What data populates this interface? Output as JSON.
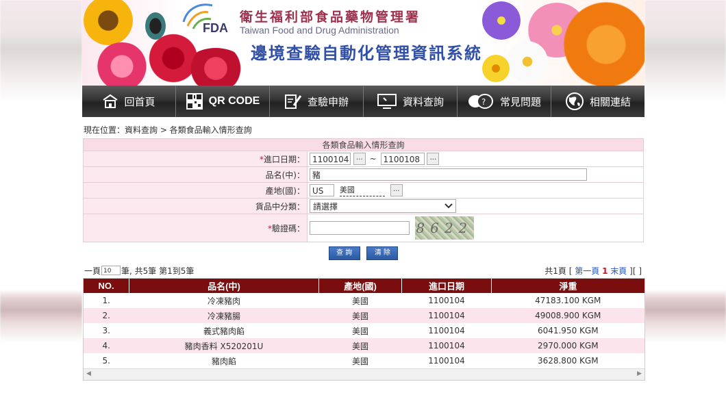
{
  "header": {
    "org_cn": "衛生福利部食品藥物管理署",
    "org_en": "Taiwan Food and Drug Administration",
    "fda_mark": "FDA",
    "system_title": "邊境查驗自動化管理資訊系統"
  },
  "nav": {
    "items": [
      {
        "label": "回首頁",
        "icon": "home-icon"
      },
      {
        "label": "QR CODE",
        "icon": "qr-code-icon"
      },
      {
        "label": "查驗申辦",
        "icon": "edit-document-icon"
      },
      {
        "label": "資料查詢",
        "icon": "monitor-icon"
      },
      {
        "label": "常見問題",
        "icon": "faq-chat-icon"
      },
      {
        "label": "相關連結",
        "icon": "globe-icon"
      }
    ]
  },
  "breadcrumb": "現在位置：資料查詢 > 各類食品輸入情形查詢",
  "form": {
    "title": "各類食品輸入情形查詢",
    "import_date": {
      "label": "進口日期：",
      "required_mark": "*",
      "from": "1100104",
      "to": "1100108",
      "separator": "~",
      "pick_label": "..."
    },
    "product_name": {
      "label": "品名(中)：",
      "value": "豬"
    },
    "origin": {
      "label": "產地(國)：",
      "code": "US",
      "name": "美國",
      "pick_label": "..."
    },
    "category": {
      "label": "貨品中分類：",
      "selected": "請選擇"
    },
    "captcha": {
      "label": "驗證碼：",
      "required_mark": "*",
      "code": "8622",
      "value": ""
    }
  },
  "buttons": {
    "query": "查 詢",
    "clear": "清 除"
  },
  "pager": {
    "prefix": "一頁",
    "page_size": "10",
    "summary": "筆, 共5筆 第1到5筆",
    "total_pages": "共1頁 [",
    "first": "第一頁",
    "current": "1",
    "last": "末頁",
    "suffix": "][ ]"
  },
  "results": {
    "columns": [
      "NO.",
      "品名(中)",
      "產地(國)",
      "進口日期",
      "淨重"
    ],
    "rows": [
      {
        "no": "1.",
        "name": "冷凍豬肉",
        "origin": "美國",
        "date": "1100104",
        "weight": "47183.100 KGM"
      },
      {
        "no": "2.",
        "name": "冷凍豬腸",
        "origin": "美國",
        "date": "1100104",
        "weight": "49008.900 KGM"
      },
      {
        "no": "3.",
        "name": "義式豬肉餡",
        "origin": "美國",
        "date": "1100104",
        "weight": "6041.950 KGM"
      },
      {
        "no": "4.",
        "name": "豬肉香料 X520201U",
        "origin": "美國",
        "date": "1100104",
        "weight": "2970.000 KGM"
      },
      {
        "no": "5.",
        "name": "豬肉餡",
        "origin": "美國",
        "date": "1100104",
        "weight": "3628.800 KGM"
      }
    ]
  },
  "colors": {
    "nav_bg": "#333333",
    "table_header": "#7a0e0e",
    "row_alt": "#fbe4ec",
    "title_blue": "#2f4fa8",
    "org_red": "#9e2f4d"
  }
}
